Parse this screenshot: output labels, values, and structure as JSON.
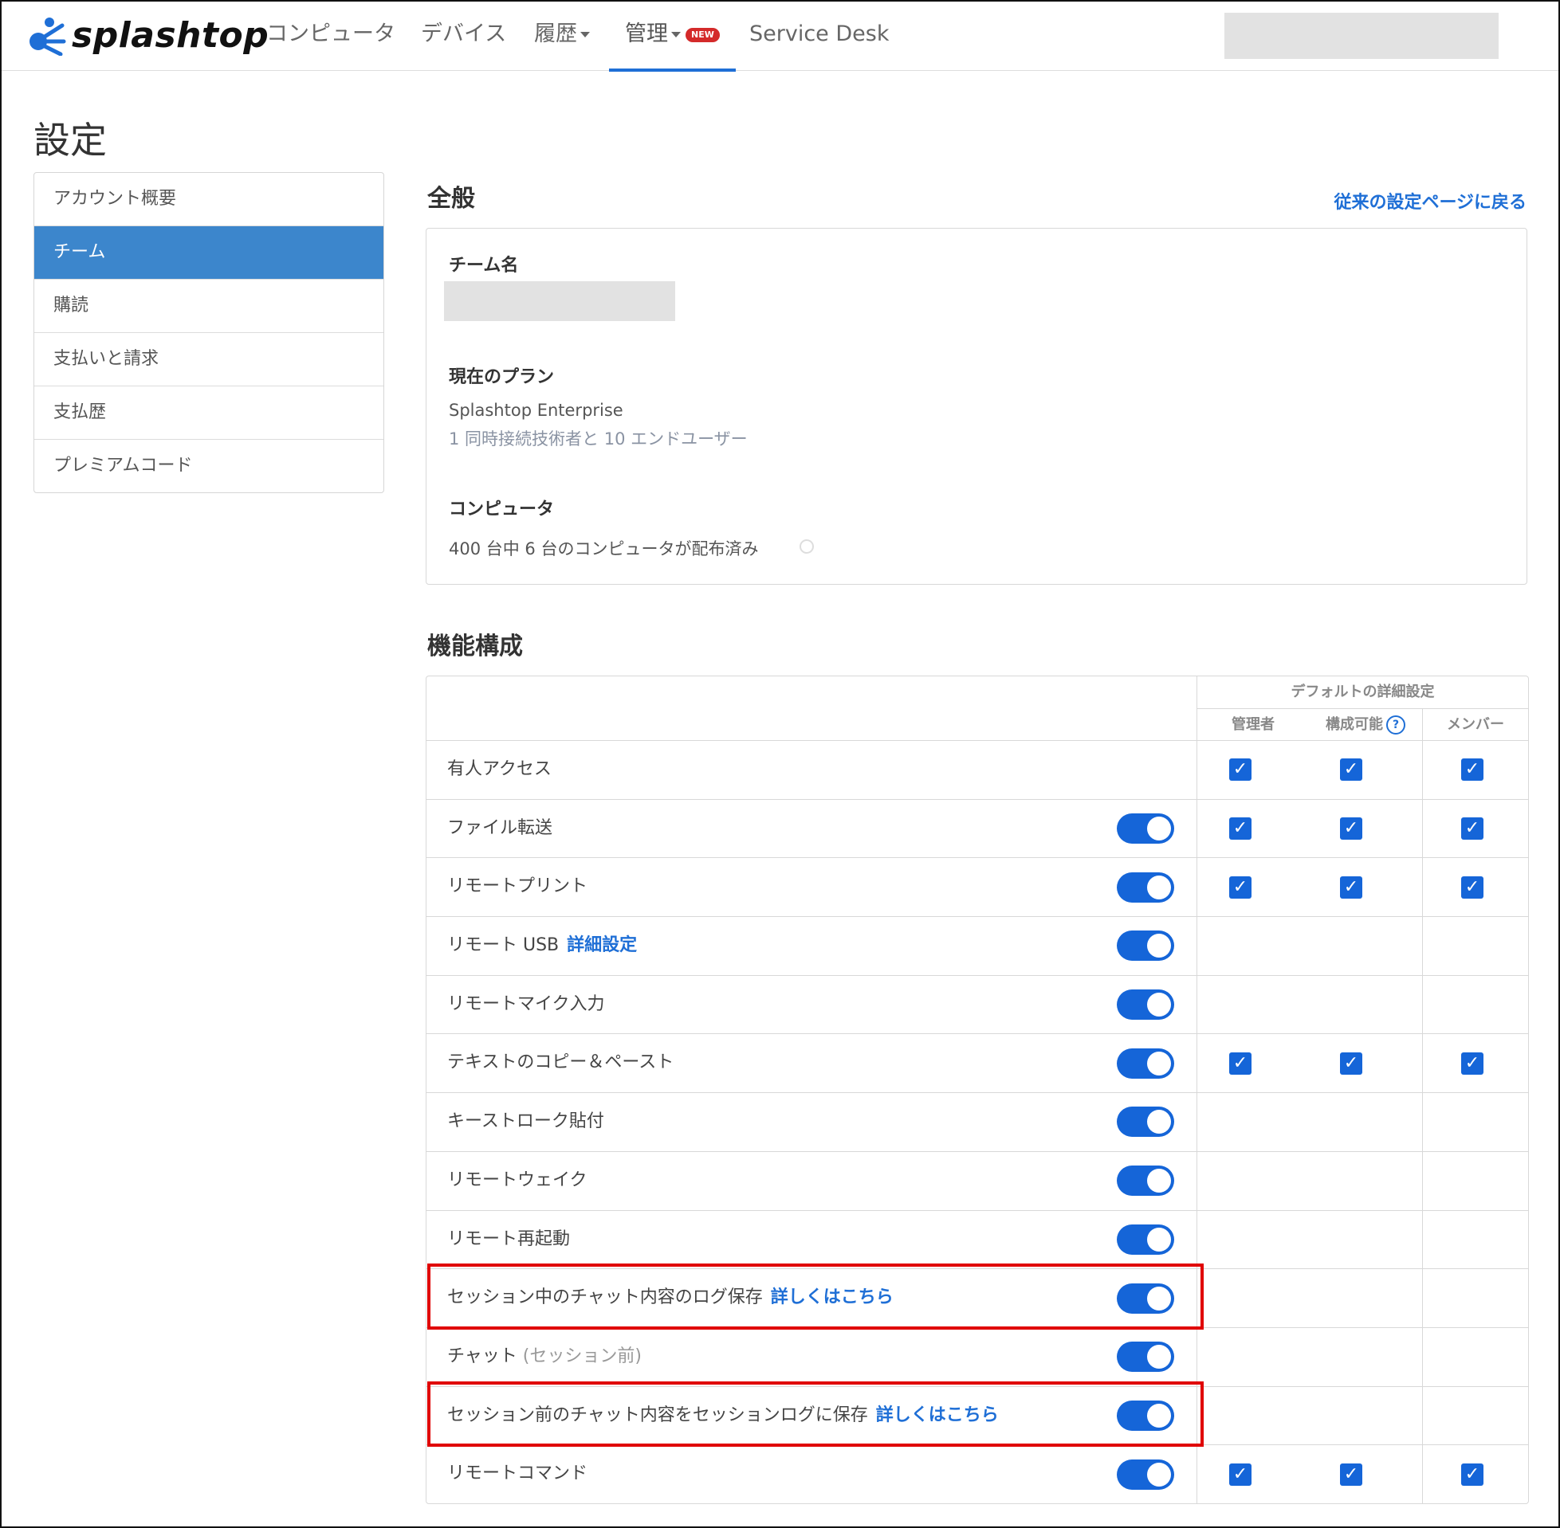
{
  "nav": {
    "logo_text": "splashtop",
    "items": [
      "コンピュータ",
      "デバイス",
      "履歴",
      "管理",
      "Service Desk"
    ],
    "new_badge": "NEW"
  },
  "page": {
    "title": "設定"
  },
  "sidebar": {
    "items": [
      {
        "label": "アカウント概要",
        "active": false
      },
      {
        "label": "チーム",
        "active": true
      },
      {
        "label": "購読",
        "active": false
      },
      {
        "label": "支払いと請求",
        "active": false
      },
      {
        "label": "支払歴",
        "active": false
      },
      {
        "label": "プレミアムコード",
        "active": false
      }
    ]
  },
  "general": {
    "title": "全般",
    "back_link": "従来の設定ページに戻る",
    "team_name_label": "チーム名",
    "plan_label": "現在のプラン",
    "plan_name": "Splashtop Enterprise",
    "plan_detail": "1 同時接続技術者と 10 エンドユーザー",
    "computer_label": "コンピュータ",
    "computer_detail": "400 台中 6 台のコンピュータが配布済み"
  },
  "features": {
    "title": "機能構成",
    "default_label": "デフォルトの詳細設定",
    "col_admin": "管理者",
    "col_configurable": "構成可能",
    "col_member": "メンバー",
    "rows": [
      {
        "name": "有人アクセス",
        "toggle": false,
        "checks": true
      },
      {
        "name": "ファイル転送",
        "toggle": true,
        "checks": true
      },
      {
        "name": "リモートプリント",
        "toggle": true,
        "checks": true
      },
      {
        "name": "リモート USB",
        "link": "詳細設定",
        "toggle": true,
        "checks": false
      },
      {
        "name": "リモートマイク入力",
        "toggle": true,
        "checks": false
      },
      {
        "name": "テキストのコピー＆ペースト",
        "toggle": true,
        "checks": true
      },
      {
        "name": "キーストローク貼付",
        "toggle": true,
        "checks": false
      },
      {
        "name": "リモートウェイク",
        "toggle": true,
        "checks": false
      },
      {
        "name": "リモート再起動",
        "toggle": true,
        "checks": false
      },
      {
        "name": "セッション中のチャット内容のログ保存",
        "link": "詳しくはこちら",
        "toggle": true,
        "checks": false,
        "highlight": true
      },
      {
        "name": "チャット",
        "sub": "(セッション前)",
        "toggle": true,
        "checks": false
      },
      {
        "name": "セッション前のチャット内容をセッションログに保存",
        "link": "詳しくはこちら",
        "toggle": true,
        "checks": false,
        "highlight": true
      },
      {
        "name": "リモートコマンド",
        "toggle": true,
        "checks": true
      }
    ]
  },
  "colors": {
    "accent": "#1565d8",
    "sidebar_active": "#3c86cc",
    "highlight": "#e00000",
    "badge": "#d42a2a"
  }
}
